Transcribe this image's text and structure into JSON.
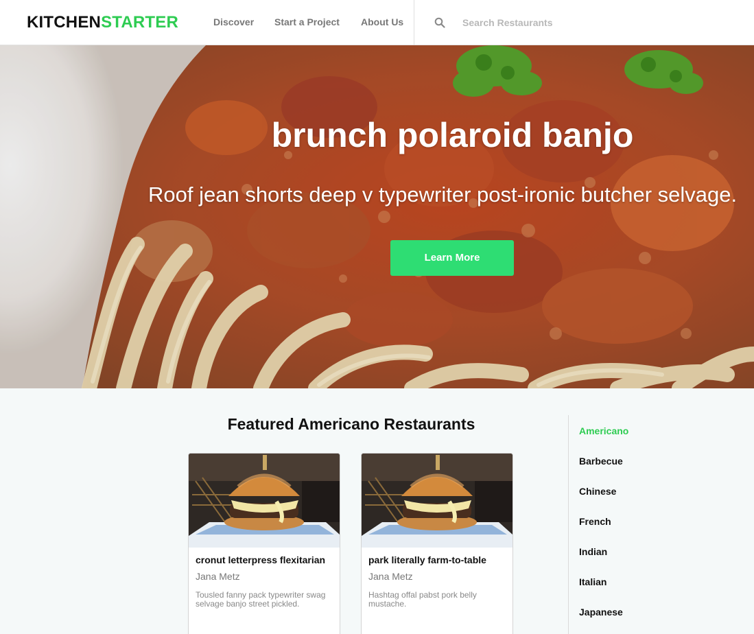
{
  "header": {
    "logo_part1": "KITCHEN",
    "logo_part2": "STARTER",
    "nav": [
      {
        "label": "Discover"
      },
      {
        "label": "Start a Project"
      },
      {
        "label": "About Us"
      }
    ],
    "search": {
      "placeholder": "Search Restaurants",
      "value": "",
      "icon": "search-icon"
    }
  },
  "hero": {
    "title": "brunch polaroid banjo",
    "subtitle": "Roof jean shorts deep v typewriter post-ironic butcher selvage.",
    "cta_label": "Learn More"
  },
  "featured": {
    "title": "Featured Americano Restaurants",
    "cards": [
      {
        "title": "cronut letterpress flexitarian",
        "author": "Jana Metz",
        "description": "Tousled fanny pack typewriter swag selvage banjo street pickled."
      },
      {
        "title": "park literally farm-to-table",
        "author": "Jana Metz",
        "description": "Hashtag offal pabst pork belly mustache."
      }
    ]
  },
  "sidebar": {
    "items": [
      {
        "label": "Americano",
        "active": true
      },
      {
        "label": "Barbecue",
        "active": false
      },
      {
        "label": "Chinese",
        "active": false
      },
      {
        "label": "French",
        "active": false
      },
      {
        "label": "Indian",
        "active": false
      },
      {
        "label": "Italian",
        "active": false
      },
      {
        "label": "Japanese",
        "active": false
      }
    ]
  },
  "colors": {
    "accent": "#2ecc52",
    "button": "#2edd73",
    "nav_text": "#777777"
  }
}
